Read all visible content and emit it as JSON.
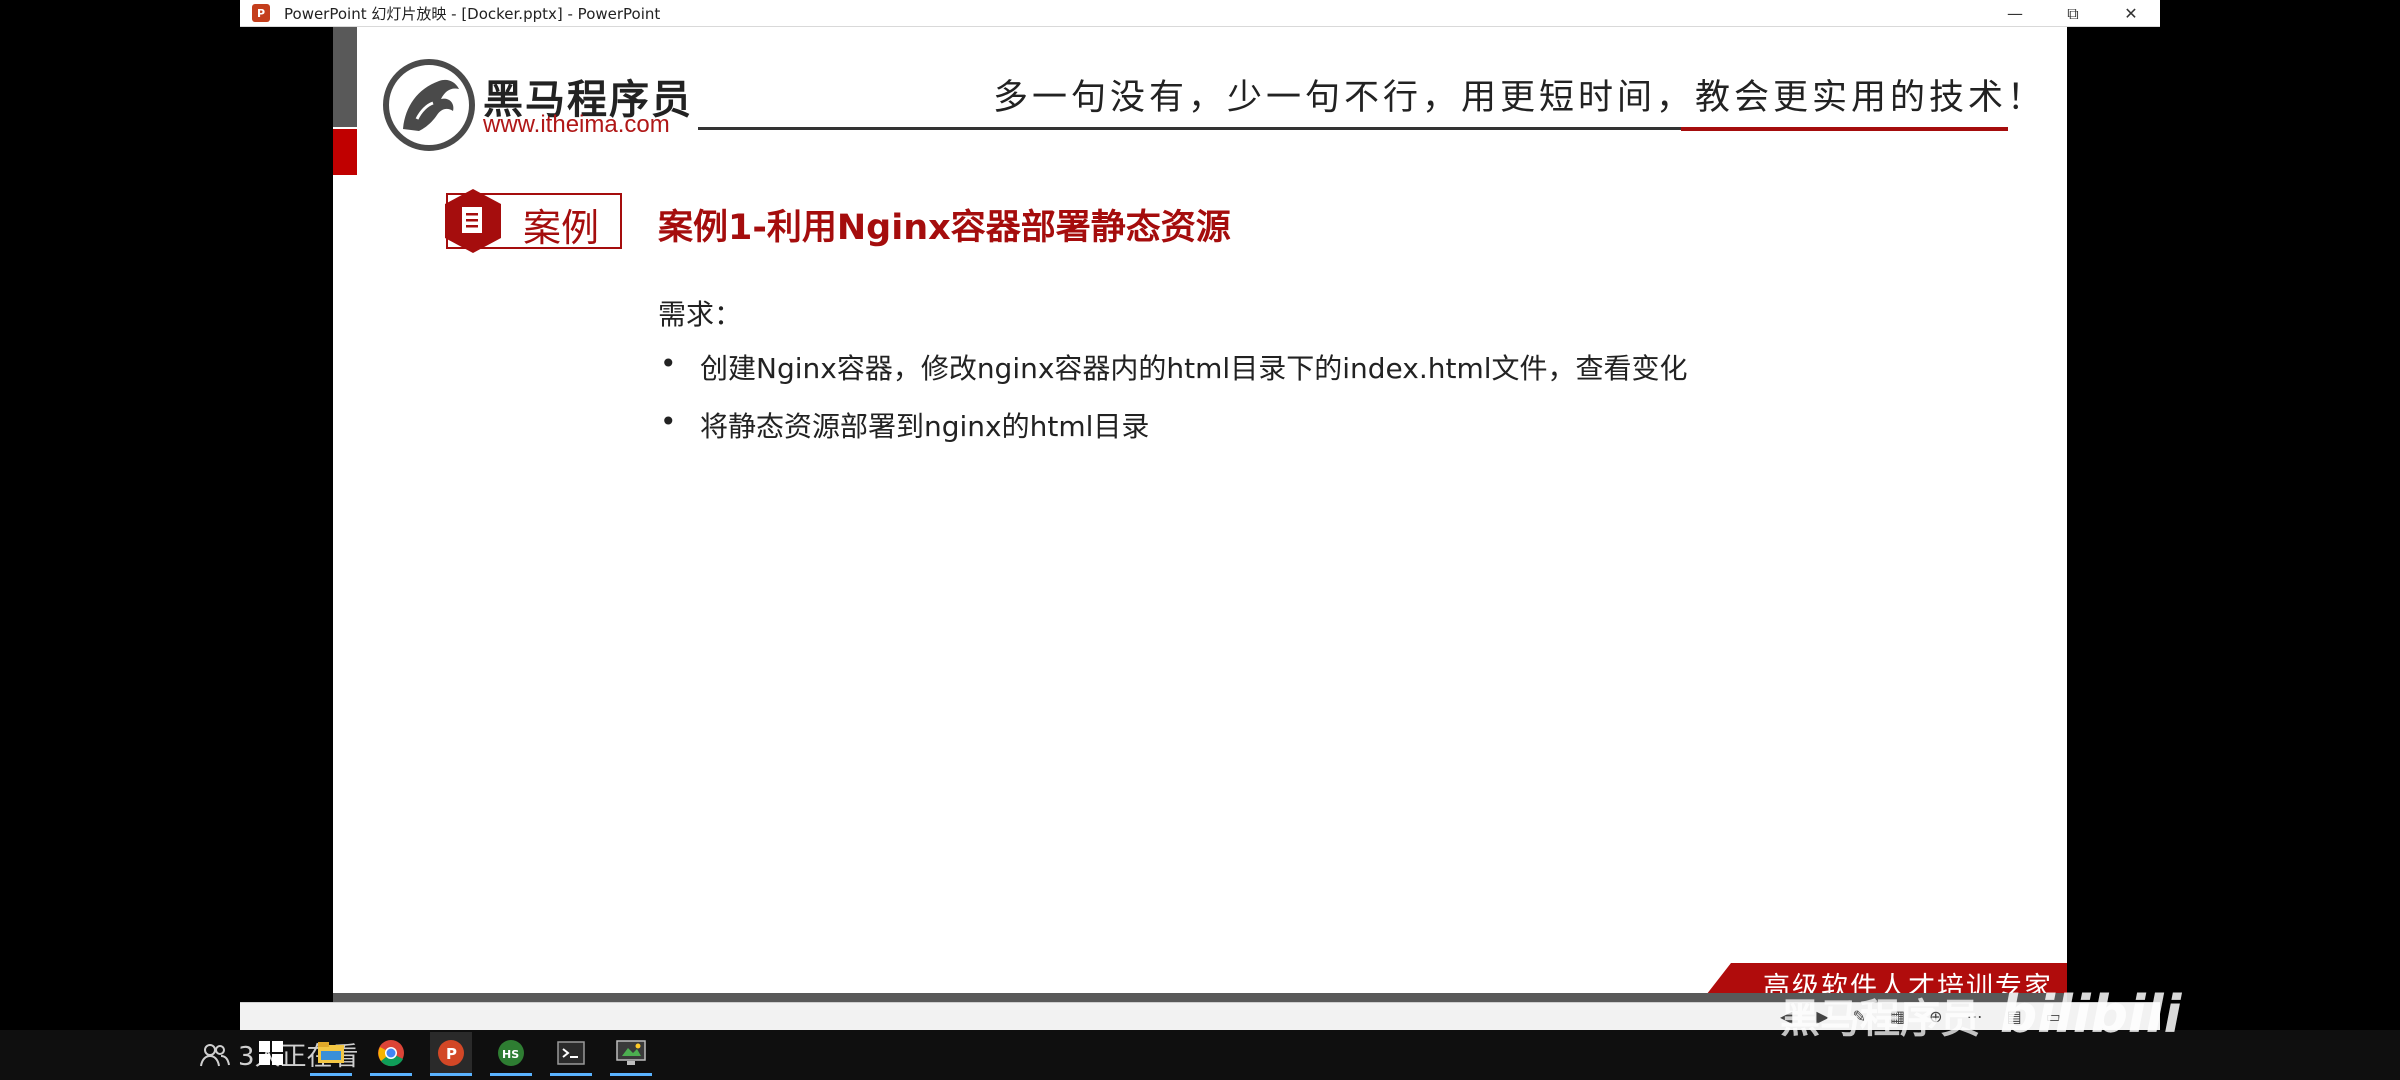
{
  "window": {
    "title": "PowerPoint 幻灯片放映 - [Docker.pptx] - PowerPoint",
    "app_icon": "P",
    "controls": {
      "minimize": "—",
      "restore": "⧉",
      "close": "✕"
    }
  },
  "slide": {
    "logo_cn": "黑马程序员",
    "logo_url": "www.itheima.com",
    "slogan": "多一句没有，少一句不行，用更短时间，教会更实用的技术！",
    "case_label": "案例",
    "title": "案例1-利用Nginx容器部署静态资源",
    "requirement_heading": "需求：",
    "bullets": [
      "创建Nginx容器，修改nginx容器内的html目录下的index.html文件，查看变化",
      "将静态资源部署到nginx的html目录"
    ],
    "bullet_char": "•",
    "footer_ribbon": "高级软件人才培训专家"
  },
  "overlay": {
    "viewers": "3人正在看",
    "watermark_text": "黑马程序员",
    "watermark_brand": "bilibili"
  },
  "colors": {
    "accent_red": "#a50d0d",
    "ribbon_red": "#b00c0c"
  }
}
